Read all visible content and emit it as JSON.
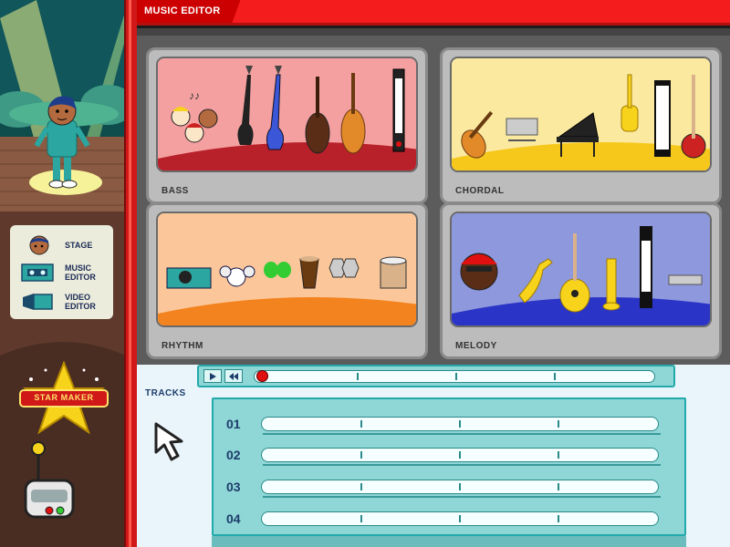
{
  "app": {
    "title": "MUSIC EDITOR",
    "logo_text": "STAR MAKER"
  },
  "nav": {
    "items": [
      {
        "label": "STAGE",
        "icon": "stage-character-icon"
      },
      {
        "label": "MUSIC\nEDITOR",
        "icon": "cassette-icon"
      },
      {
        "label": "VIDEO\nEDITOR",
        "icon": "video-camera-icon"
      }
    ]
  },
  "categories": [
    {
      "label": "BASS",
      "color": "#f4a0a0"
    },
    {
      "label": "CHORDAL",
      "color": "#fbe9a0"
    },
    {
      "label": "RHYTHM",
      "color": "#fbc79a"
    },
    {
      "label": "MELODY",
      "color": "#8e98dc"
    }
  ],
  "tracks": {
    "tab_label": "TRACKS",
    "rows": [
      {
        "number": "01"
      },
      {
        "number": "02"
      },
      {
        "number": "03"
      },
      {
        "number": "04"
      }
    ]
  },
  "transport": {
    "play_icon": "play-icon",
    "rewind_icon": "rewind-icon",
    "playhead_position": 0
  },
  "colors": {
    "header_red": "#f41c1c",
    "panel_teal": "#8fd6d6",
    "sidebar_brown": "#5f3a2c"
  }
}
